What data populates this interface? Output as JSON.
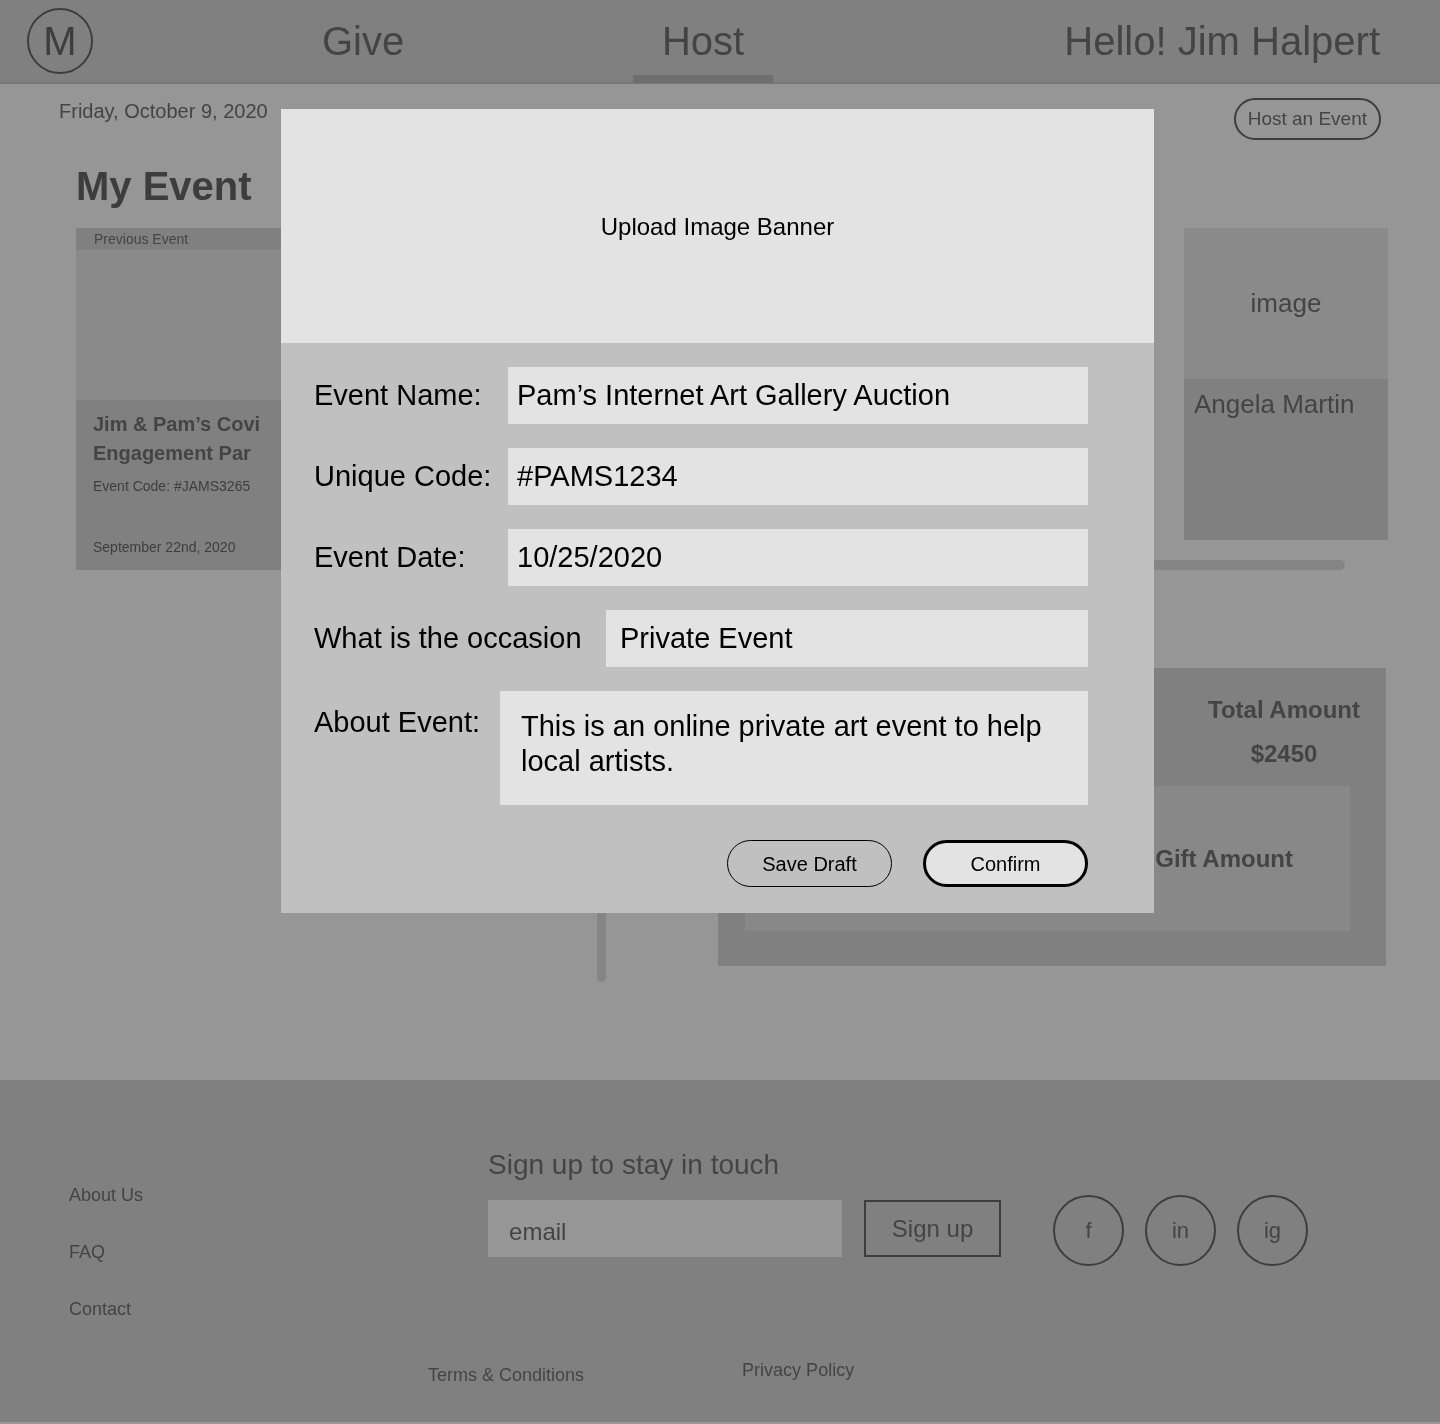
{
  "header": {
    "logo": "M",
    "nav": [
      {
        "label": "Give",
        "selected": false
      },
      {
        "label": "Host",
        "selected": true
      }
    ],
    "greeting": "Hello! Jim Halpert"
  },
  "page": {
    "date": "Friday, October 9, 2020",
    "host_button": "Host an Event",
    "title": "My Event",
    "previous_card": {
      "tag": "Previous Event",
      "title_lines": [
        "Jim & Pam’s Covi",
        "Engagement Par"
      ],
      "code": "Event Code: #JAMS3265",
      "date": "September 22nd, 2020"
    },
    "guest_card": {
      "image_label": "image",
      "name": "Angela Martin"
    },
    "amount_panel": {
      "label": "Total Amount",
      "value": "$2450",
      "gift_label": "Gift Amount"
    }
  },
  "modal": {
    "banner": "Upload Image Banner",
    "fields": [
      {
        "label": "Event Name:",
        "value": "Pam’s Internet Art Gallery Auction",
        "kind": "text"
      },
      {
        "label": "Unique Code:",
        "value": "#PAMS1234",
        "kind": "text"
      },
      {
        "label": "Event Date:",
        "value": "10/25/2020",
        "kind": "text"
      },
      {
        "label": "What is the occasion",
        "value": "Private Event",
        "kind": "select"
      },
      {
        "label": "About Event:",
        "value": "This is an online private art event to help local artists.",
        "kind": "textarea"
      }
    ],
    "buttons": [
      {
        "label": "Save Draft",
        "primary": false
      },
      {
        "label": "Confirm",
        "primary": true
      }
    ]
  },
  "footer": {
    "links": [
      "About Us",
      "FAQ",
      "Contact"
    ],
    "signup_title": "Sign up to stay in touch",
    "email_placeholder": "email",
    "signup_button": "Sign up",
    "social": [
      "f",
      "in",
      "ig"
    ],
    "bottom_links": [
      "Terms & Conditions",
      "Privacy Policy"
    ]
  }
}
